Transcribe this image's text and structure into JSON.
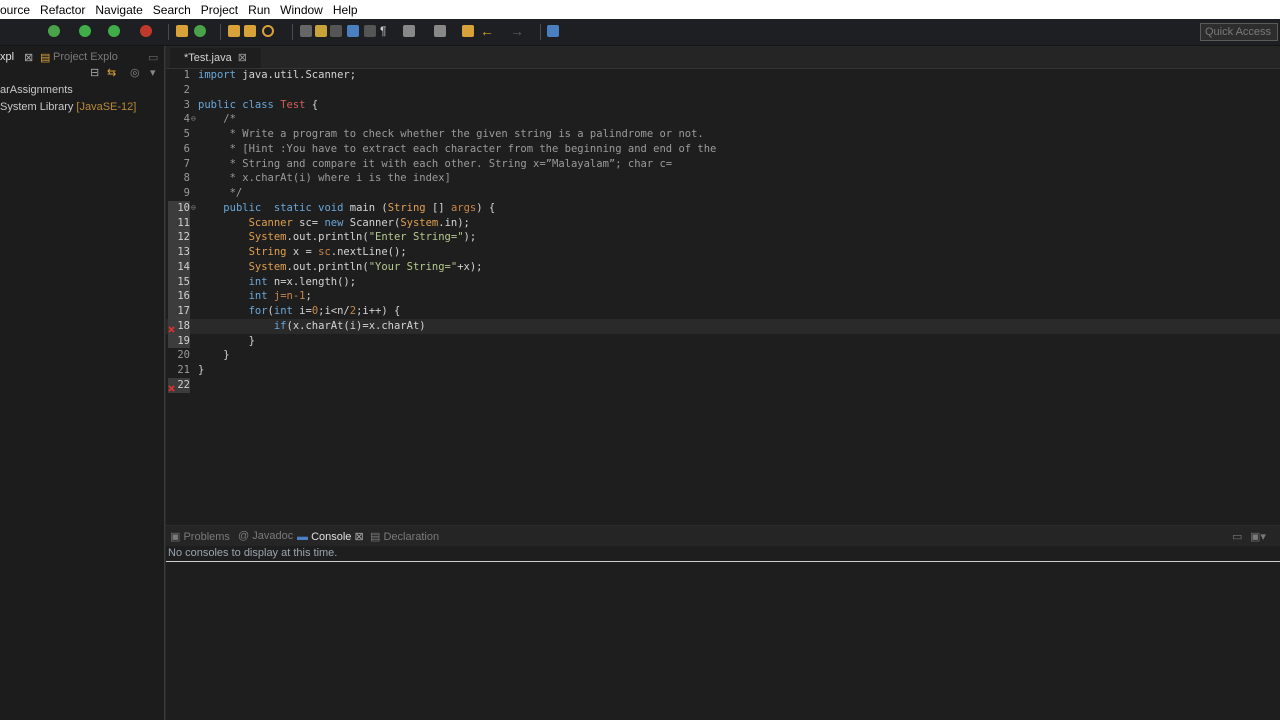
{
  "menu": [
    "ource",
    "Refactor",
    "Navigate",
    "Search",
    "Project",
    "Run",
    "Window",
    "Help"
  ],
  "toolbar": {
    "quick_access_placeholder": "Quick Access"
  },
  "left": {
    "tab1": "xpl",
    "tab2": "Project Explo",
    "tree": [
      {
        "label": "arAssignments"
      },
      {
        "label": "System Library",
        "lib": "[JavaSE-12]"
      }
    ]
  },
  "editor": {
    "tab_label": "*Test.java",
    "lines": [
      {
        "n": "1",
        "html": "<span class='k'>import</span> java.util.Scanner;"
      },
      {
        "n": "2",
        "html": ""
      },
      {
        "n": "3",
        "html": "<span class='k'>public class</span> <span class='tn'>Test</span> {"
      },
      {
        "n": "4",
        "fold": true,
        "html": "    <span class='cm'>/*</span>"
      },
      {
        "n": "5",
        "html": "     <span class='cm'>* Write a program to check whether the given string is a palindrome or not.</span>"
      },
      {
        "n": "6",
        "html": "     <span class='cm'>* [Hint :You have to extract each character from the beginning and end of the</span>"
      },
      {
        "n": "7",
        "html": "     <span class='cm'>* String and compare it with each other. String x=”Malayalam”; char c=</span>"
      },
      {
        "n": "8",
        "html": "     <span class='cm'>* x.charAt(i) where i is the index]</span>"
      },
      {
        "n": "9",
        "html": "     <span class='cm'>*/</span>"
      },
      {
        "n": "10",
        "fold": true,
        "hl": true,
        "html": "    <span class='k'>public</span>  <span class='k'>static void</span> main (<span class='cls'>String</span> [] <span class='fld'>args</span>) {"
      },
      {
        "n": "11",
        "hl": true,
        "html": "        <span class='cls'>Scanner</span> sc= <span class='k'>new</span> Scanner(<span class='cls'>System</span>.in);"
      },
      {
        "n": "12",
        "hl": true,
        "html": "        <span class='cls'>System</span>.out.println(<span class='str'>\"Enter String=\"</span>);"
      },
      {
        "n": "13",
        "hl": true,
        "html": "        <span class='cls'>String</span> x = <span class='fld'>sc</span>.nextLine();"
      },
      {
        "n": "14",
        "hl": true,
        "html": "        <span class='cls'>System</span>.out.println(<span class='str'>\"Your String=\"</span>+x);"
      },
      {
        "n": "15",
        "hl": true,
        "html": "        <span class='k'>int</span> n=x.length();"
      },
      {
        "n": "16",
        "hl": true,
        "html": "        <span class='k'>int</span> <span class='fld'>j=n-1</span>;"
      },
      {
        "n": "17",
        "hl": true,
        "html": "        <span class='k'>for</span>(<span class='k'>int</span> i=<span class='fld'>0</span>;i&lt;n/<span class='fld'>2</span>;i++) {"
      },
      {
        "n": "18",
        "hl": true,
        "current": true,
        "error": true,
        "html": "            <span class='k'>if</span>(x.charAt(i)=x.charAt)"
      },
      {
        "n": "19",
        "hl": true,
        "html": "        }"
      },
      {
        "n": "20",
        "html": "    }"
      },
      {
        "n": "21",
        "html": "}"
      },
      {
        "n": "22",
        "hl": true,
        "error": true,
        "html": ""
      }
    ]
  },
  "bottom": {
    "tabs": [
      "Problems",
      "Javadoc",
      "Console",
      "Declaration"
    ],
    "active": "Console",
    "message": "No consoles to display at this time."
  },
  "colors": {
    "editor_bg": "#1e1e1e",
    "keyword": "#6aa7d8",
    "error": "#e03030"
  }
}
